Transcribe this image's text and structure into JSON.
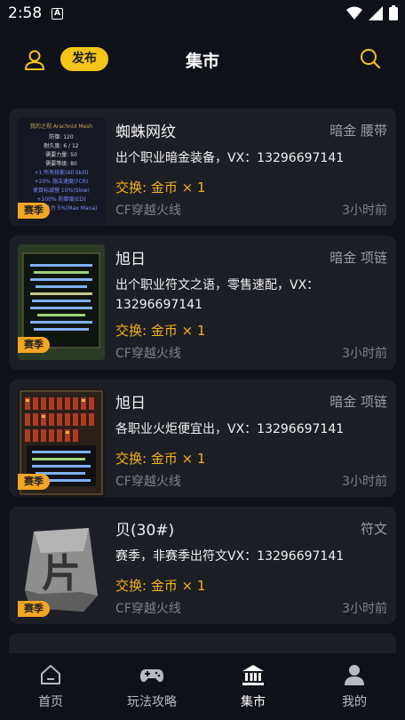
{
  "status": {
    "time": "2:58",
    "notif": "A"
  },
  "header": {
    "publish_label": "发布",
    "title": "集市"
  },
  "listings": [
    {
      "title": "蜘蛛网纹",
      "category": "暗金 腰带",
      "description": "出个职业暗金装备，VX：13296697141",
      "exchange": "交换: 金币 × 1",
      "game": "CF穿越火线",
      "time": "3小时前",
      "badge": "赛季"
    },
    {
      "title": "旭日",
      "category": "暗金 项链",
      "description": "出个职业符文之语，零售速配，VX：13296697141",
      "exchange": "交换: 金币 × 1",
      "game": "CF穿越火线",
      "time": "3小时前",
      "badge": "赛季"
    },
    {
      "title": "旭日",
      "category": "暗金 项链",
      "description": "各职业火炬便宜出，VX：13296697141",
      "exchange": "交换: 金币 × 1",
      "game": "CF穿越火线",
      "time": "3小时前",
      "badge": "赛季"
    },
    {
      "title": "贝(30#)",
      "category": "符文",
      "description": "赛季，非赛季出符文VX：13296697141",
      "exchange": "交换: 金币 × 1",
      "game": "CF穿越火线",
      "time": "3小时前",
      "badge": "赛季"
    }
  ],
  "thumb1_lines": [
    "我的之视 Arachnid Mesh",
    "防御: 120",
    "耐久度: 6 / 12",
    "需要力量: 50",
    "需要等级: 80",
    "+1 所有技能(All Skill)",
    "+20% 施法速度(FCR)",
    "使目标减慢 10%(Slow)",
    "+100% 防御度(ED)",
    "法力 5%(Max Mana)"
  ],
  "thumb4_glyph": "片",
  "nav": [
    {
      "label": "首页",
      "icon": "home-icon",
      "active": false
    },
    {
      "label": "玩法攻略",
      "icon": "gamepad-icon",
      "active": false
    },
    {
      "label": "集市",
      "icon": "bank-icon",
      "active": true
    },
    {
      "label": "我的",
      "icon": "person-icon",
      "active": false
    }
  ]
}
